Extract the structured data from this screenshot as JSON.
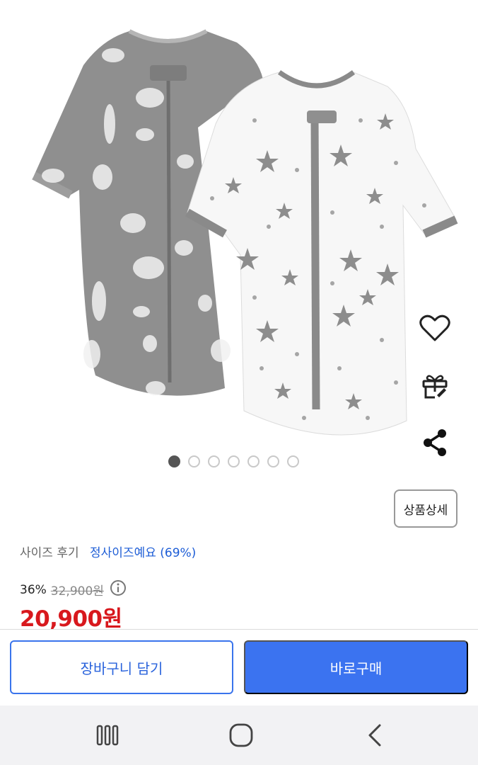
{
  "product_image": {
    "dots_total": 7,
    "active_dot": 0
  },
  "side_actions": {
    "wishlist_icon": "heart-outline-icon",
    "gift_icon": "gift-icon",
    "share_icon": "share-icon"
  },
  "detail_button": {
    "label": "상품상세"
  },
  "size_review": {
    "label": "사이즈 후기",
    "value": "정사이즈예요 (69%)"
  },
  "pricing": {
    "discount": "36%",
    "original_price": "32,900원",
    "price": "20,900원"
  },
  "actions": {
    "cart_label": "장바구니 담기",
    "buy_label": "바로구매"
  },
  "navbar": {
    "recents_icon": "recents-icon",
    "home_icon": "home-icon",
    "back_icon": "back-icon"
  },
  "colors": {
    "accent": "#3b73f0",
    "price": "#d8181d",
    "link": "#1d5dd6",
    "garment_gray": "#8e8e8e"
  }
}
